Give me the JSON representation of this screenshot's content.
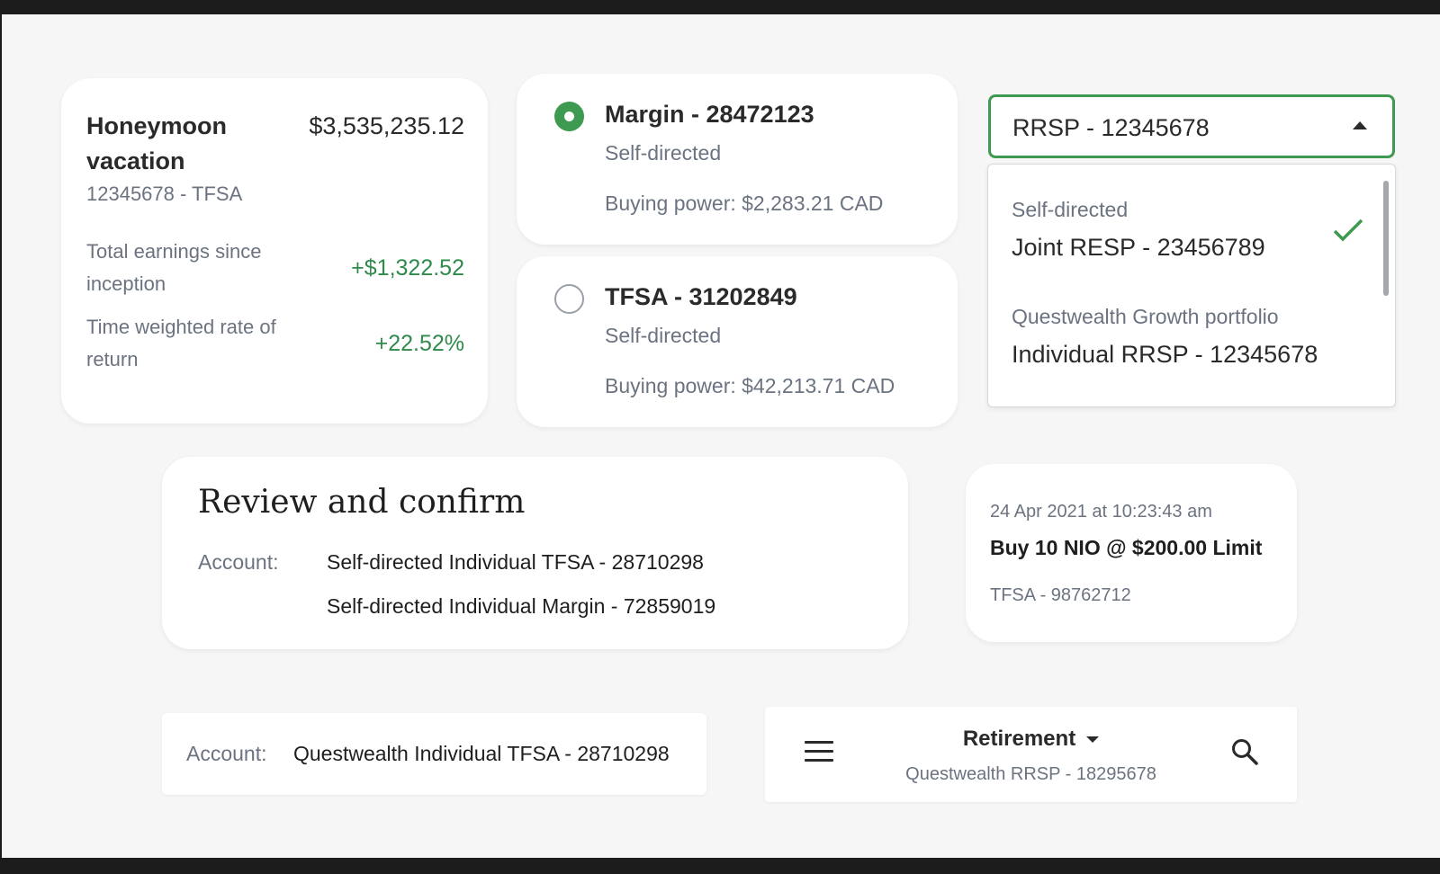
{
  "goal_card": {
    "name": "Honeymoon vacation",
    "balance": "$3,535,235.12",
    "account": "12345678 - TFSA",
    "earnings_label": "Total earnings since inception",
    "earnings_value": "+$1,322.52",
    "twrr_label": "Time weighted rate of return",
    "twrr_value": "+22.52%"
  },
  "radio_accounts": [
    {
      "title": "Margin - 28472123",
      "type": "Self-directed",
      "buying_power": "Buying power: $2,283.21 CAD",
      "selected": true
    },
    {
      "title": "TFSA - 31202849",
      "type": "Self-directed",
      "buying_power": "Buying power: $42,213.71 CAD",
      "selected": false
    }
  ],
  "account_select": {
    "value": "RRSP - 12345678",
    "options": [
      {
        "category": "Self-directed",
        "name": "Joint RESP - 23456789",
        "checked": true
      },
      {
        "category": "Questwealth Growth portfolio",
        "name": "Individual RRSP - 12345678",
        "checked": false
      }
    ]
  },
  "review": {
    "title": "Review and confirm",
    "account_label": "Account:",
    "accounts": [
      "Self-directed Individual TFSA - 28710298",
      "Self-directed Individual Margin - 72859019"
    ]
  },
  "order": {
    "timestamp": "24 Apr 2021 at 10:23:43 am",
    "description": "Buy 10 NIO @ $200.00 Limit",
    "account": "TFSA - 98762712"
  },
  "account_bar": {
    "label": "Account:",
    "value": "Questwealth Individual TFSA - 28710298"
  },
  "app_header": {
    "title": "Retirement",
    "subtitle": "Questwealth RRSP - 18295678",
    "icons": [
      "menu-icon",
      "search-icon"
    ]
  },
  "colors": {
    "accent_green": "#3d9a50",
    "positive_green": "#2f8a4c",
    "muted_text": "#6b7380"
  }
}
